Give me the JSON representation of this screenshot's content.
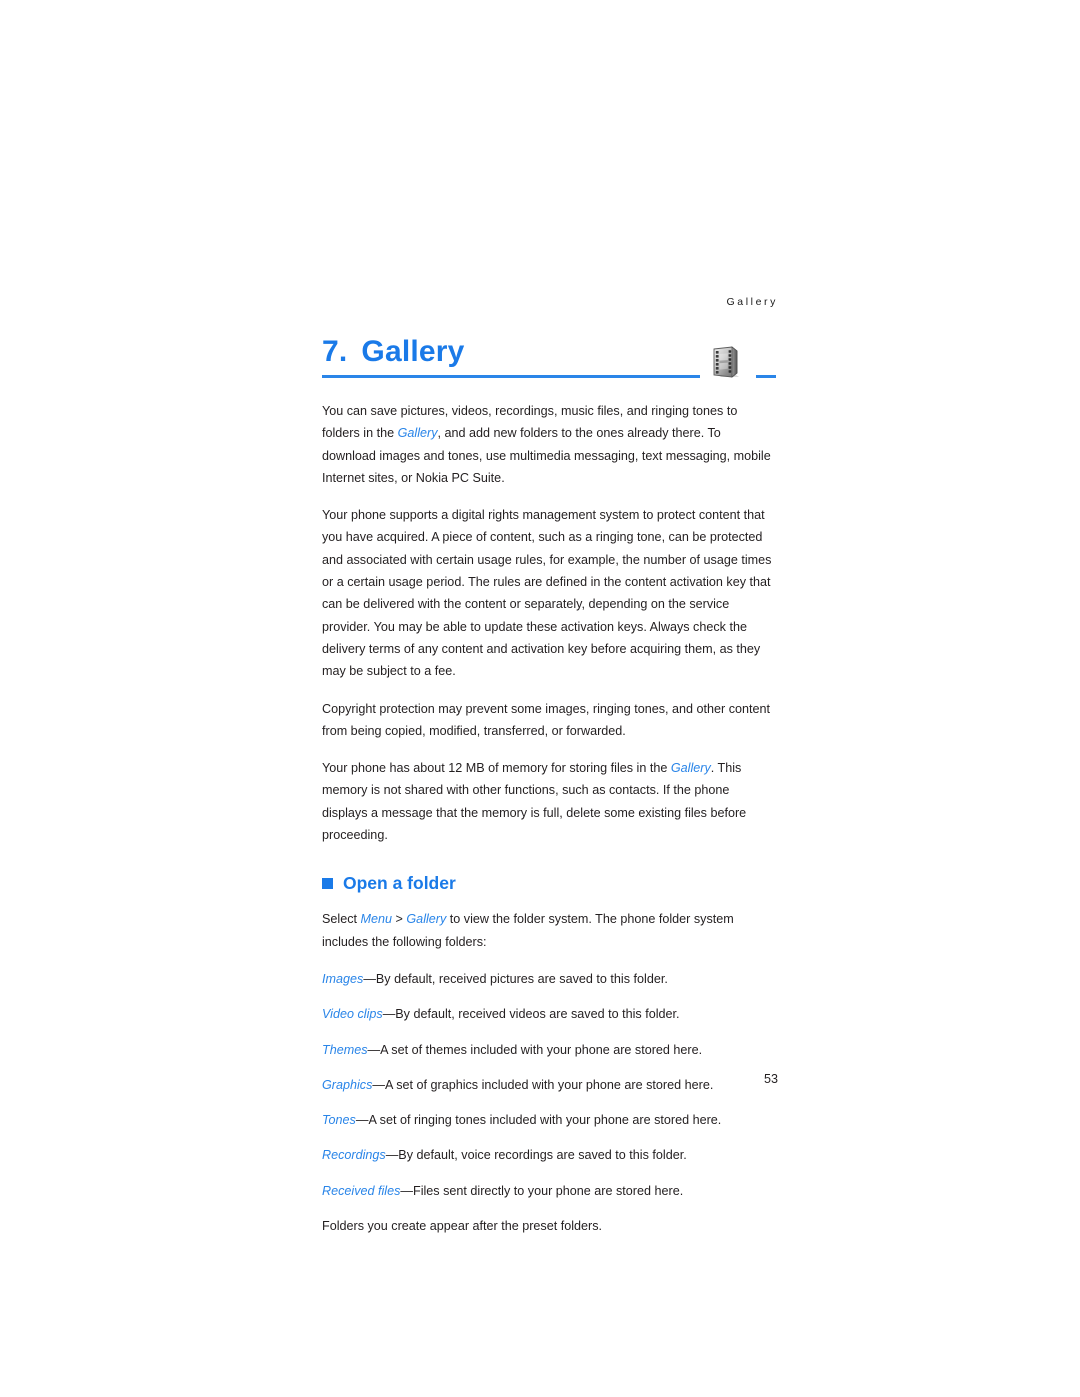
{
  "page": {
    "running_head": "Gallery",
    "page_number": "53",
    "accent_color": "#1a7ae8",
    "rule_color": "#2a85e8",
    "text_color": "#231f20"
  },
  "chapter": {
    "number": "7.",
    "title": "Gallery",
    "icon_name": "film-strip-icon"
  },
  "paragraphs": [
    {
      "id": "intro",
      "runs": [
        {
          "text": "You can save pictures, videos, recordings, music files, and ringing tones to folders in the ",
          "style": "plain"
        },
        {
          "text": "Gallery",
          "style": "emph"
        },
        {
          "text": ", and add new folders to the ones already there. To download images and tones, use multimedia messaging, text messaging, mobile Internet sites, or Nokia PC Suite.",
          "style": "plain"
        }
      ]
    },
    {
      "id": "drm",
      "runs": [
        {
          "text": "Your phone supports a digital rights management system to protect content that you have acquired. A piece of content, such as a ringing tone, can be protected and associated with certain usage rules, for example, the number of usage times or a certain usage period. The rules are defined in the content activation key that can be delivered with the content or separately, depending on the service provider. You may be able to update these activation keys. Always check the delivery terms of any content and activation key before acquiring them, as they may be subject to a fee.",
          "style": "plain"
        }
      ]
    },
    {
      "id": "copyright",
      "runs": [
        {
          "text": "Copyright protection may prevent some images, ringing tones, and other content from being copied, modified, transferred, or forwarded.",
          "style": "plain"
        }
      ]
    },
    {
      "id": "memory",
      "runs": [
        {
          "text": "Your phone has about 12 MB of memory for storing files in the ",
          "style": "plain"
        },
        {
          "text": "Gallery",
          "style": "emph"
        },
        {
          "text": ". This memory is not shared with other functions, such as contacts. If the phone displays a message that the memory is full, delete some existing files before proceeding.",
          "style": "plain"
        }
      ]
    }
  ],
  "section": {
    "heading": "Open a folder",
    "bullet_name": "square-bullet-icon",
    "intro": {
      "runs": [
        {
          "text": "Select ",
          "style": "plain"
        },
        {
          "text": "Menu",
          "style": "emph"
        },
        {
          "text": " > ",
          "style": "plain"
        },
        {
          "text": "Gallery",
          "style": "emph"
        },
        {
          "text": " to view the folder system. The phone folder system includes the following folders:",
          "style": "plain"
        }
      ]
    },
    "folders": [
      {
        "name": "Images",
        "sep": "—",
        "description": "By default, received pictures are saved to this folder."
      },
      {
        "name": "Video clips",
        "sep": "—",
        "description": "By default, received videos are saved to this folder."
      },
      {
        "name": "Themes",
        "sep": "—",
        "description": "A set of themes included with your phone are stored here."
      },
      {
        "name": "Graphics",
        "sep": "—",
        "description": "A set of graphics included with your phone are stored here."
      },
      {
        "name": "Tones",
        "sep": "—",
        "description": "A set of ringing tones included with your phone are stored here."
      },
      {
        "name": "Recordings",
        "sep": "—",
        "description": "By default, voice recordings are saved to this folder."
      },
      {
        "name": "Received files",
        "sep": "—",
        "description": "Files sent directly to your phone are stored here."
      }
    ],
    "closing_note": "Folders you create appear after the preset folders."
  }
}
